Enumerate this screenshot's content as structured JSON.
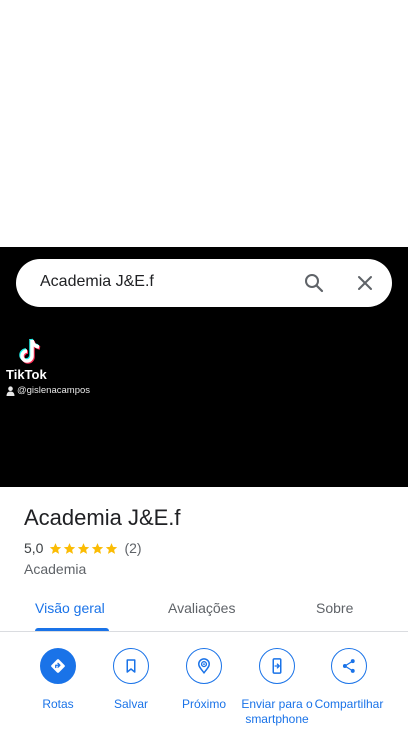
{
  "search": {
    "query": "Academia J&E.f"
  },
  "photo": {
    "watermark_brand": "TikTok",
    "watermark_handle": "@gislenacampos"
  },
  "place": {
    "name": "Academia J&E.f",
    "rating": "5,0",
    "stars": 5,
    "review_count": "(2)",
    "category": "Academia"
  },
  "tabs": [
    {
      "label": "Visão geral",
      "active": true
    },
    {
      "label": "Avaliações",
      "active": false
    },
    {
      "label": "Sobre",
      "active": false
    }
  ],
  "actions": [
    {
      "label": "Rotas",
      "icon": "directions-icon"
    },
    {
      "label": "Salvar",
      "icon": "bookmark-icon"
    },
    {
      "label": "Próximo",
      "icon": "nearby-icon"
    },
    {
      "label": "Enviar para o smartphone",
      "icon": "send-to-phone-icon"
    },
    {
      "label": "Compartilhar",
      "icon": "share-icon"
    }
  ],
  "colors": {
    "accent": "#1a73e8",
    "star": "#fbbc04",
    "hero_background": "#000000"
  }
}
